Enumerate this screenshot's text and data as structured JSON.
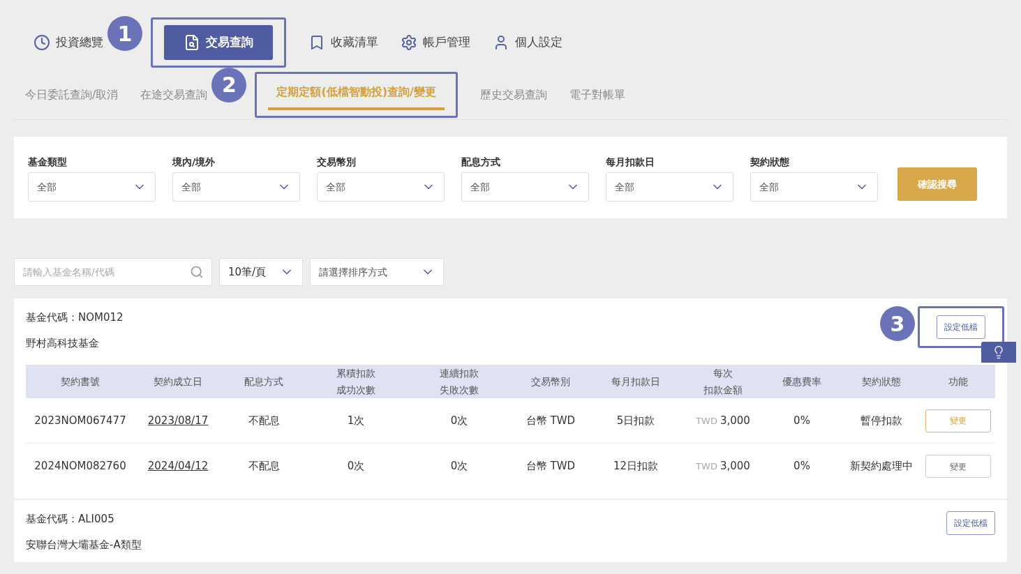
{
  "nav": [
    {
      "label": "投資總覽",
      "selected": false
    },
    {
      "label": "交易查詢",
      "selected": true,
      "annotation": "1"
    },
    {
      "label": "收藏清單",
      "selected": false
    },
    {
      "label": "帳戶管理",
      "selected": false
    },
    {
      "label": "個人設定",
      "selected": false
    }
  ],
  "subtabs": [
    {
      "label": "今日委託查詢/取消",
      "selected": false
    },
    {
      "label": "在途交易查詢",
      "selected": false
    },
    {
      "label": "定期定額(低檔智動投)查詢/變更",
      "selected": true,
      "annotation": "2"
    },
    {
      "label": "歷史交易查詢",
      "selected": false
    },
    {
      "label": "電子對帳單",
      "selected": false
    }
  ],
  "filters": [
    {
      "label": "基金類型",
      "value": "全部"
    },
    {
      "label": "境內/境外",
      "value": "全部"
    },
    {
      "label": "交易幣別",
      "value": "全部"
    },
    {
      "label": "配息方式",
      "value": "全部"
    },
    {
      "label": "每月扣款日",
      "value": "全部"
    },
    {
      "label": "契約狀態",
      "value": "全部"
    }
  ],
  "search_button": "確認搜尋",
  "toolbar": {
    "search": {
      "placeholder": "請輸入基金名稱/代碼"
    },
    "page_size": "10筆/頁",
    "sort": {
      "placeholder": "請選擇排序方式"
    }
  },
  "funds": [
    {
      "code": "基金代碼：NOM012",
      "name": "野村高科技基金",
      "action": "設定低檔",
      "annotation": "3",
      "table": {
        "columns": [
          [
            "契約書號"
          ],
          [
            "契約成立日"
          ],
          [
            "配息方式"
          ],
          [
            "累積扣款",
            "成功次數"
          ],
          [
            "連續扣款",
            "失敗次數"
          ],
          [
            "交易幣別"
          ],
          [
            "每月扣款日"
          ],
          [
            "每次",
            "扣款金額"
          ],
          [
            "優惠費率"
          ],
          [
            "契約狀態"
          ],
          [
            "功能"
          ]
        ],
        "rows": [
          {
            "contract": "2023NOM067477",
            "date": "2023/08/17",
            "dividend": "不配息",
            "success": "1次",
            "fail": "0次",
            "currency": "台幣 TWD",
            "day": "5日扣款",
            "unit": "TWD",
            "amount": "3,000",
            "rate": "0%",
            "status": "暫停扣款",
            "action": "變更",
            "highlighted": true
          },
          {
            "contract": "2024NOM082760",
            "date": "2024/04/12",
            "dividend": "不配息",
            "success": "0次",
            "fail": "0次",
            "currency": "台幣 TWD",
            "day": "12日扣款",
            "unit": "TWD",
            "amount": "3,000",
            "rate": "0%",
            "status": "新契約處理中",
            "action": "變更",
            "highlighted": false
          }
        ]
      }
    },
    {
      "code": "基金代碼：ALI005",
      "name": "安聯台灣大壩基金-A類型",
      "action": "設定低檔"
    }
  ]
}
